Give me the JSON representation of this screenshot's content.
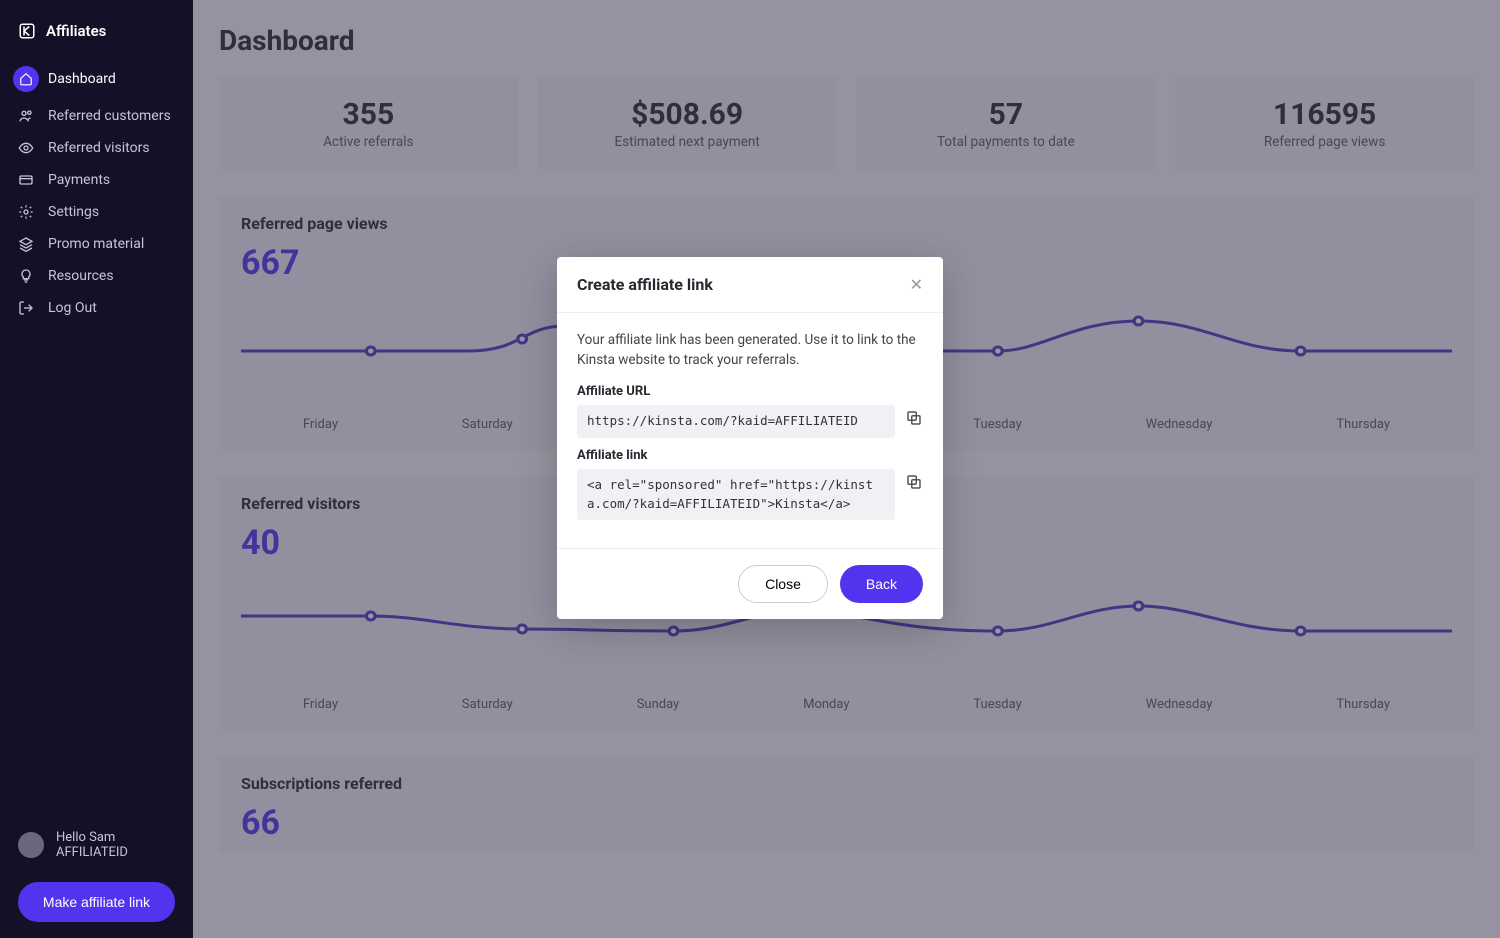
{
  "brand": {
    "name": "Affiliates"
  },
  "sidebar": {
    "items": [
      {
        "label": "Dashboard",
        "icon": "home-icon",
        "active": true
      },
      {
        "label": "Referred customers",
        "icon": "people-icon"
      },
      {
        "label": "Referred visitors",
        "icon": "eye-icon"
      },
      {
        "label": "Payments",
        "icon": "card-icon"
      },
      {
        "label": "Settings",
        "icon": "gear-icon"
      },
      {
        "label": "Promo material",
        "icon": "layers-icon"
      },
      {
        "label": "Resources",
        "icon": "bulb-icon"
      },
      {
        "label": "Log Out",
        "icon": "logout-icon"
      }
    ],
    "user": {
      "greeting": "Hello Sam",
      "id": "AFFILIATEID"
    },
    "make_link_label": "Make affiliate link"
  },
  "page": {
    "title": "Dashboard"
  },
  "stats": [
    {
      "value": "355",
      "label": "Active referrals"
    },
    {
      "value": "$508.69",
      "label": "Estimated next payment"
    },
    {
      "value": "57",
      "label": "Total payments to date"
    },
    {
      "value": "116595",
      "label": "Referred page views"
    }
  ],
  "panels": {
    "views": {
      "title": "Referred page views",
      "big": "667"
    },
    "visitors": {
      "title": "Referred visitors",
      "big": "40"
    },
    "subs": {
      "title": "Subscriptions referred",
      "big": "66"
    }
  },
  "days": [
    "Friday",
    "Saturday",
    "Sunday",
    "Monday",
    "Tuesday",
    "Wednesday",
    "Thursday"
  ],
  "modal": {
    "title": "Create affiliate link",
    "intro": "Your affiliate link has been generated. Use it to link to the Kinsta website to track your referrals.",
    "url_label": "Affiliate URL",
    "url_value": "https://kinsta.com/?kaid=AFFILIATEID",
    "link_label": "Affiliate link",
    "link_value": "<a rel=\"sponsored\" href=\"https://kinsta.com/?kaid=AFFILIATEID\">Kinsta</a>",
    "close_label": "Close",
    "back_label": "Back"
  },
  "chart_data": [
    {
      "type": "line",
      "title": "Referred page views",
      "categories": [
        "Friday",
        "Saturday",
        "Sunday",
        "Monday",
        "Tuesday",
        "Wednesday",
        "Thursday"
      ],
      "values": [
        60,
        60,
        35,
        62,
        60,
        30,
        60
      ]
    },
    {
      "type": "line",
      "title": "Referred visitors",
      "categories": [
        "Friday",
        "Saturday",
        "Sunday",
        "Monday",
        "Tuesday",
        "Wednesday",
        "Thursday"
      ],
      "values": [
        45,
        58,
        60,
        40,
        60,
        35,
        60
      ]
    }
  ]
}
